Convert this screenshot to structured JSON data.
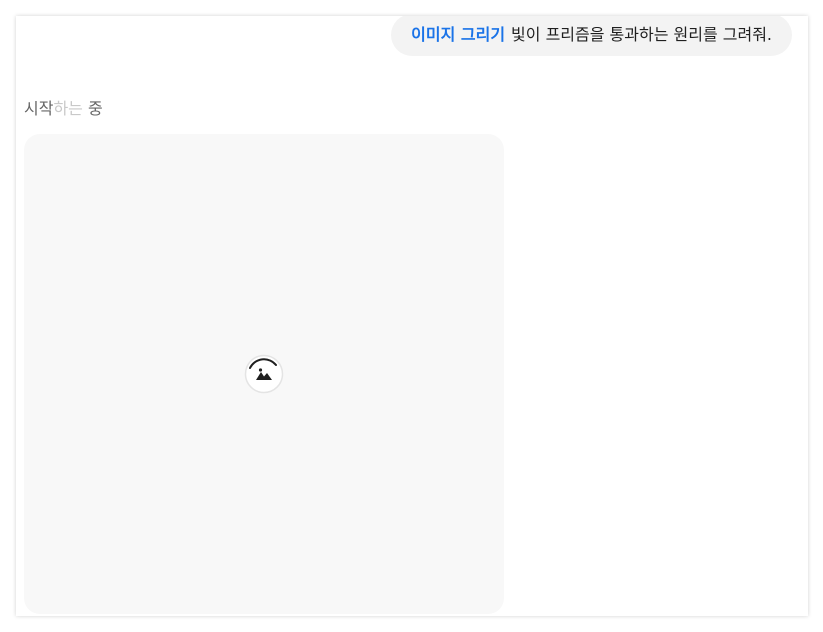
{
  "conversation": {
    "user_message": {
      "tool_label": "이미지 그리기",
      "text": "빛이 프리즘을 통과하는 원리를 그려줘."
    },
    "generation": {
      "status_part1": "시작",
      "status_part2": "하는",
      "status_part3": "중",
      "placeholder_icon": "image-icon"
    }
  },
  "colors": {
    "accent": "#1a73e8",
    "bubble_bg": "#f3f3f3",
    "card_bg": "#f8f8f8",
    "status_text": "#666666"
  }
}
